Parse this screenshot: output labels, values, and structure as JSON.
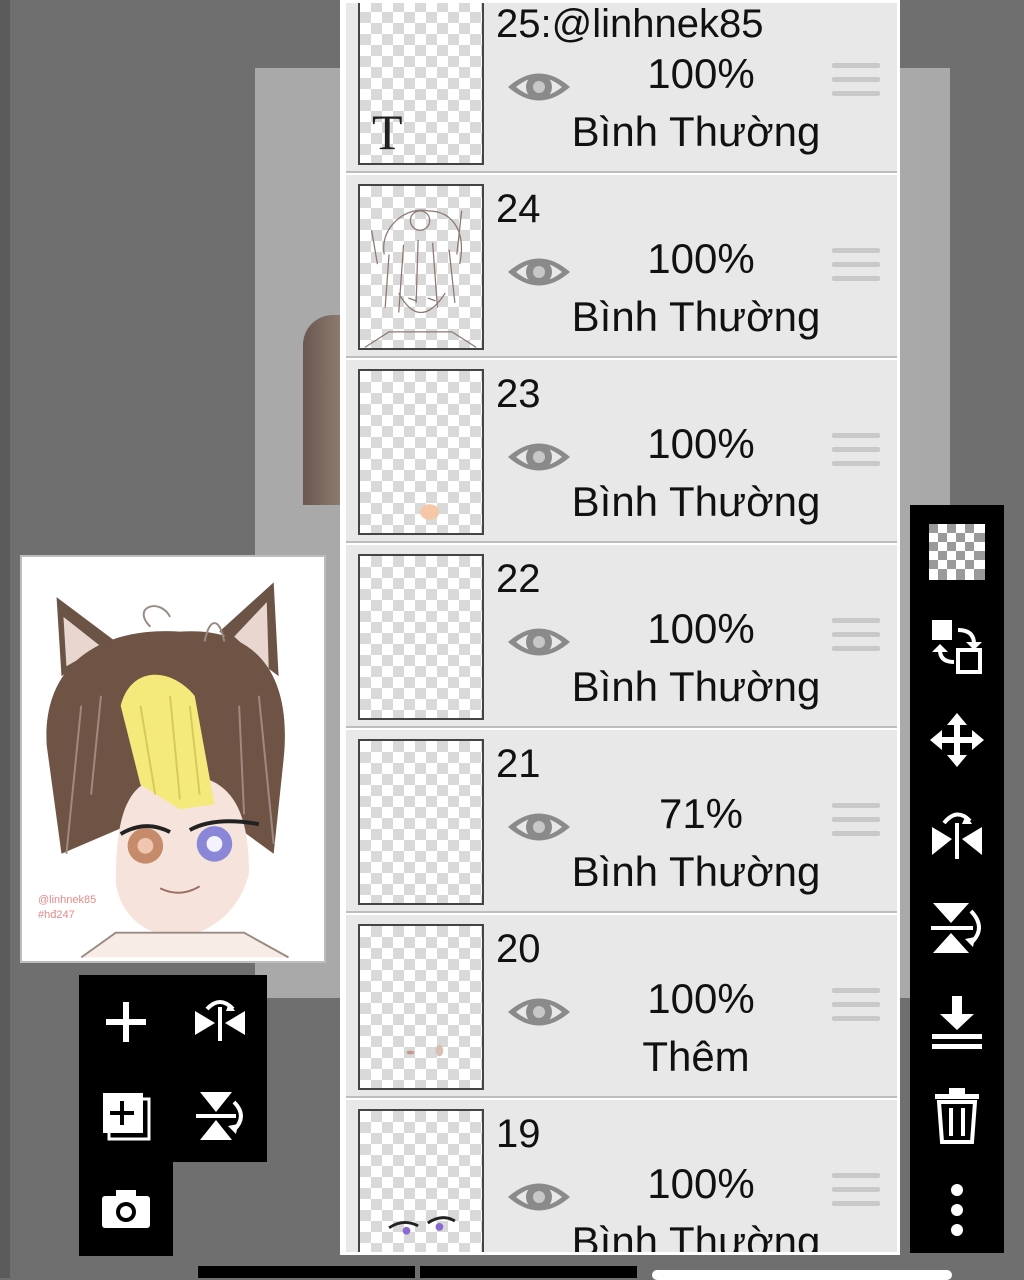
{
  "layers": [
    {
      "name": "25:@linhnek85",
      "opacity": "100%",
      "blend": "Bình Thường",
      "thumb": "text"
    },
    {
      "name": "24",
      "opacity": "100%",
      "blend": "Bình Thường",
      "thumb": "lineart"
    },
    {
      "name": "23",
      "opacity": "100%",
      "blend": "Bình Thường",
      "thumb": "blush"
    },
    {
      "name": "22",
      "opacity": "100%",
      "blend": "Bình Thường",
      "thumb": "empty"
    },
    {
      "name": "21",
      "opacity": "71%",
      "blend": "Bình Thường",
      "thumb": "empty"
    },
    {
      "name": "20",
      "opacity": "100%",
      "blend": "Thêm",
      "thumb": "spots"
    },
    {
      "name": "19",
      "opacity": "100%",
      "blend": "Bình Thường",
      "thumb": "eyes"
    }
  ],
  "thumb_text_glyph": "T",
  "preview": {
    "watermark_line1": "@linhnek85",
    "watermark_line2": "#hđ247"
  },
  "icons": {
    "visibility": "eye-icon",
    "reorder": "drag-handle-icon",
    "right_toolbar": [
      "transparency-icon",
      "swap-layers-icon",
      "move-icon",
      "flip-horizontal-icon",
      "flip-vertical-icon",
      "merge-down-icon",
      "trash-icon",
      "more-icon"
    ],
    "left_toolbar": [
      "add-layer-icon",
      "flip-horizontal-icon",
      "add-copy-layer-icon",
      "flip-vertical-icon",
      "camera-icon"
    ]
  },
  "colors": {
    "background": "#6f6f6f",
    "panel_row": "#e8e8e8",
    "toolbar": "#000000",
    "eye": "#8a8a8a",
    "handle": "#c9c9c9"
  }
}
